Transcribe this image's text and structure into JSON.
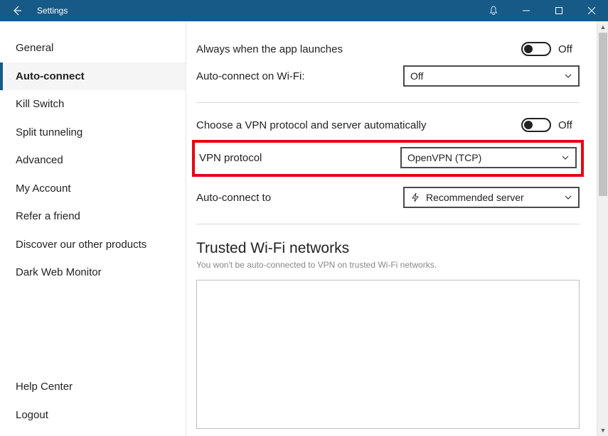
{
  "window": {
    "title": "Settings"
  },
  "sidebar": {
    "items": [
      {
        "label": "General",
        "active": false
      },
      {
        "label": "Auto-connect",
        "active": true
      },
      {
        "label": "Kill Switch",
        "active": false
      },
      {
        "label": "Split tunneling",
        "active": false
      },
      {
        "label": "Advanced",
        "active": false
      },
      {
        "label": "My Account",
        "active": false
      },
      {
        "label": "Refer a friend",
        "active": false
      },
      {
        "label": "Discover our other products",
        "active": false
      },
      {
        "label": "Dark Web Monitor",
        "active": false
      }
    ],
    "bottom": [
      {
        "label": "Help Center"
      },
      {
        "label": "Logout"
      }
    ]
  },
  "settings": {
    "launch_label": "Always when the app launches",
    "launch_state": "Off",
    "wifi_label": "Auto-connect on Wi-Fi:",
    "wifi_value": "Off",
    "auto_protocol_label": "Choose a VPN protocol and server automatically",
    "auto_protocol_state": "Off",
    "vpn_protocol_label": "VPN protocol",
    "vpn_protocol_value": "OpenVPN (TCP)",
    "auto_connect_to_label": "Auto-connect to",
    "auto_connect_to_value": "Recommended server",
    "trusted_title": "Trusted Wi-Fi networks",
    "trusted_sub": "You won't be auto-connected to VPN on trusted Wi-Fi networks."
  }
}
